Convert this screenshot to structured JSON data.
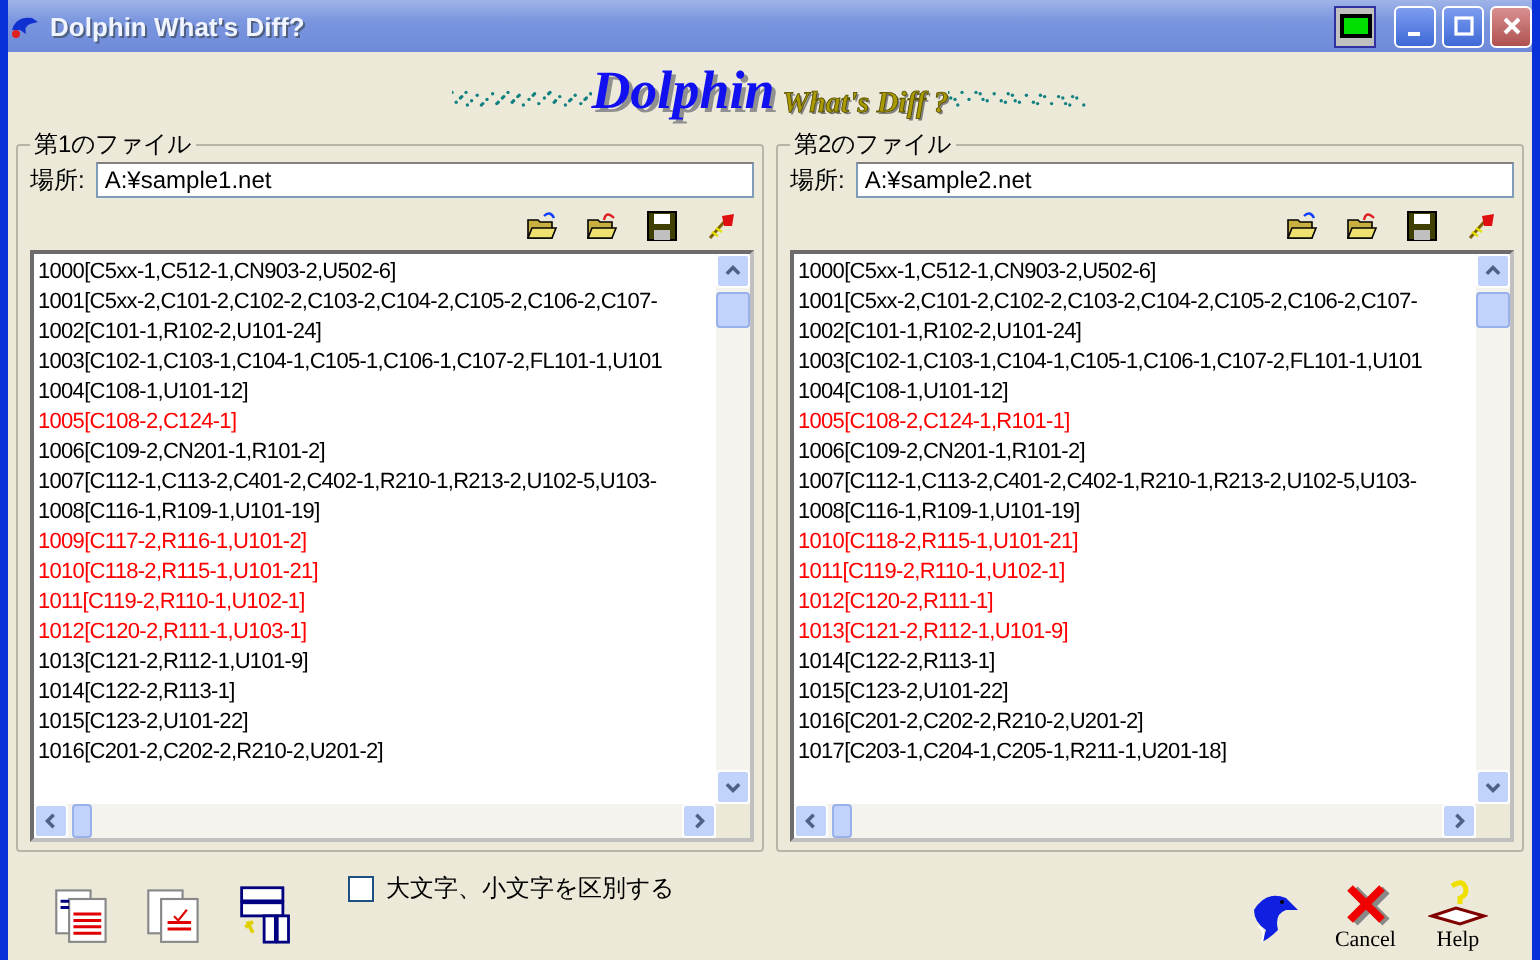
{
  "window": {
    "title": "Dolphin What's Diff?"
  },
  "logo": {
    "title": "Dolphin",
    "subtitle": "What's Diff ?"
  },
  "panels": [
    {
      "title": "第1のファイル",
      "location_label": "場所:",
      "location": "A:¥sample1.net",
      "lines": [
        {
          "text": "1000[C5xx-1,C512-1,CN903-2,U502-6]",
          "changed": false
        },
        {
          "text": "1001[C5xx-2,C101-2,C102-2,C103-2,C104-2,C105-2,C106-2,C107-",
          "changed": false
        },
        {
          "text": "1002[C101-1,R102-2,U101-24]",
          "changed": false
        },
        {
          "text": "1003[C102-1,C103-1,C104-1,C105-1,C106-1,C107-2,FL101-1,U101",
          "changed": false
        },
        {
          "text": "1004[C108-1,U101-12]",
          "changed": false
        },
        {
          "text": "1005[C108-2,C124-1]",
          "changed": true
        },
        {
          "text": "1006[C109-2,CN201-1,R101-2]",
          "changed": false
        },
        {
          "text": "1007[C112-1,C113-2,C401-2,C402-1,R210-1,R213-2,U102-5,U103-",
          "changed": false
        },
        {
          "text": "1008[C116-1,R109-1,U101-19]",
          "changed": false
        },
        {
          "text": "1009[C117-2,R116-1,U101-2]",
          "changed": true
        },
        {
          "text": "1010[C118-2,R115-1,U101-21]",
          "changed": true
        },
        {
          "text": "1011[C119-2,R110-1,U102-1]",
          "changed": true
        },
        {
          "text": "1012[C120-2,R111-1,U103-1]",
          "changed": true
        },
        {
          "text": "1013[C121-2,R112-1,U101-9]",
          "changed": false
        },
        {
          "text": "1014[C122-2,R113-1]",
          "changed": false
        },
        {
          "text": "1015[C123-2,U101-22]",
          "changed": false
        },
        {
          "text": "1016[C201-2,C202-2,R210-2,U201-2]",
          "changed": false
        }
      ]
    },
    {
      "title": "第2のファイル",
      "location_label": "場所:",
      "location": "A:¥sample2.net",
      "lines": [
        {
          "text": "1000[C5xx-1,C512-1,CN903-2,U502-6]",
          "changed": false
        },
        {
          "text": "1001[C5xx-2,C101-2,C102-2,C103-2,C104-2,C105-2,C106-2,C107-",
          "changed": false
        },
        {
          "text": "1002[C101-1,R102-2,U101-24]",
          "changed": false
        },
        {
          "text": "1003[C102-1,C103-1,C104-1,C105-1,C106-1,C107-2,FL101-1,U101",
          "changed": false
        },
        {
          "text": "1004[C108-1,U101-12]",
          "changed": false
        },
        {
          "text": "1005[C108-2,C124-1,R101-1]",
          "changed": true
        },
        {
          "text": "1006[C109-2,CN201-1,R101-2]",
          "changed": false
        },
        {
          "text": "1007[C112-1,C113-2,C401-2,C402-1,R210-1,R213-2,U102-5,U103-",
          "changed": false
        },
        {
          "text": "1008[C116-1,R109-1,U101-19]",
          "changed": false
        },
        {
          "text": "1010[C118-2,R115-1,U101-21]",
          "changed": true
        },
        {
          "text": "1011[C119-2,R110-1,U102-1]",
          "changed": true
        },
        {
          "text": "1012[C120-2,R111-1]",
          "changed": true
        },
        {
          "text": "1013[C121-2,R112-1,U101-9]",
          "changed": true
        },
        {
          "text": "1014[C122-2,R113-1]",
          "changed": false
        },
        {
          "text": "1015[C123-2,U101-22]",
          "changed": false
        },
        {
          "text": "1016[C201-2,C202-2,R210-2,U201-2]",
          "changed": false
        },
        {
          "text": "1017[C203-1,C204-1,C205-1,R211-1,U201-18]",
          "changed": false
        }
      ]
    }
  ],
  "case_option": {
    "label": "大文字、小文字を区別する",
    "checked": false
  },
  "buttons": [
    {
      "label": "Cancel",
      "kind": "cancel"
    },
    {
      "label": "Help",
      "kind": "help"
    }
  ]
}
